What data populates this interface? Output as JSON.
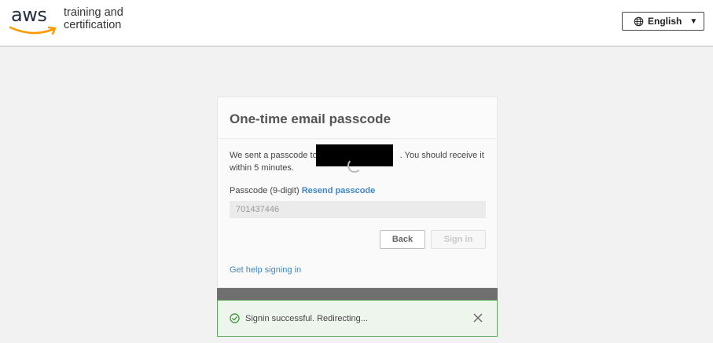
{
  "header": {
    "logo_text": "aws",
    "brand_line1": "training and",
    "brand_line2": "certification",
    "language_label": "English"
  },
  "card": {
    "title": "One-time email passcode",
    "message_pre": "We sent a passcode to",
    "message_post": ". You should receive it",
    "message_line2": "within 5 minutes.",
    "passcode_label": "Passcode (9-digit)",
    "resend_label": "Resend passcode",
    "passcode_value": "701437446",
    "back_label": "Back",
    "signin_label": "Sign in",
    "help_label": "Get help signing in"
  },
  "toast": {
    "message": "Signin successful. Redirecting..."
  },
  "colors": {
    "accent_orange": "#ff9900",
    "link_blue": "#3f88c5",
    "success_green": "#5fa85b"
  }
}
